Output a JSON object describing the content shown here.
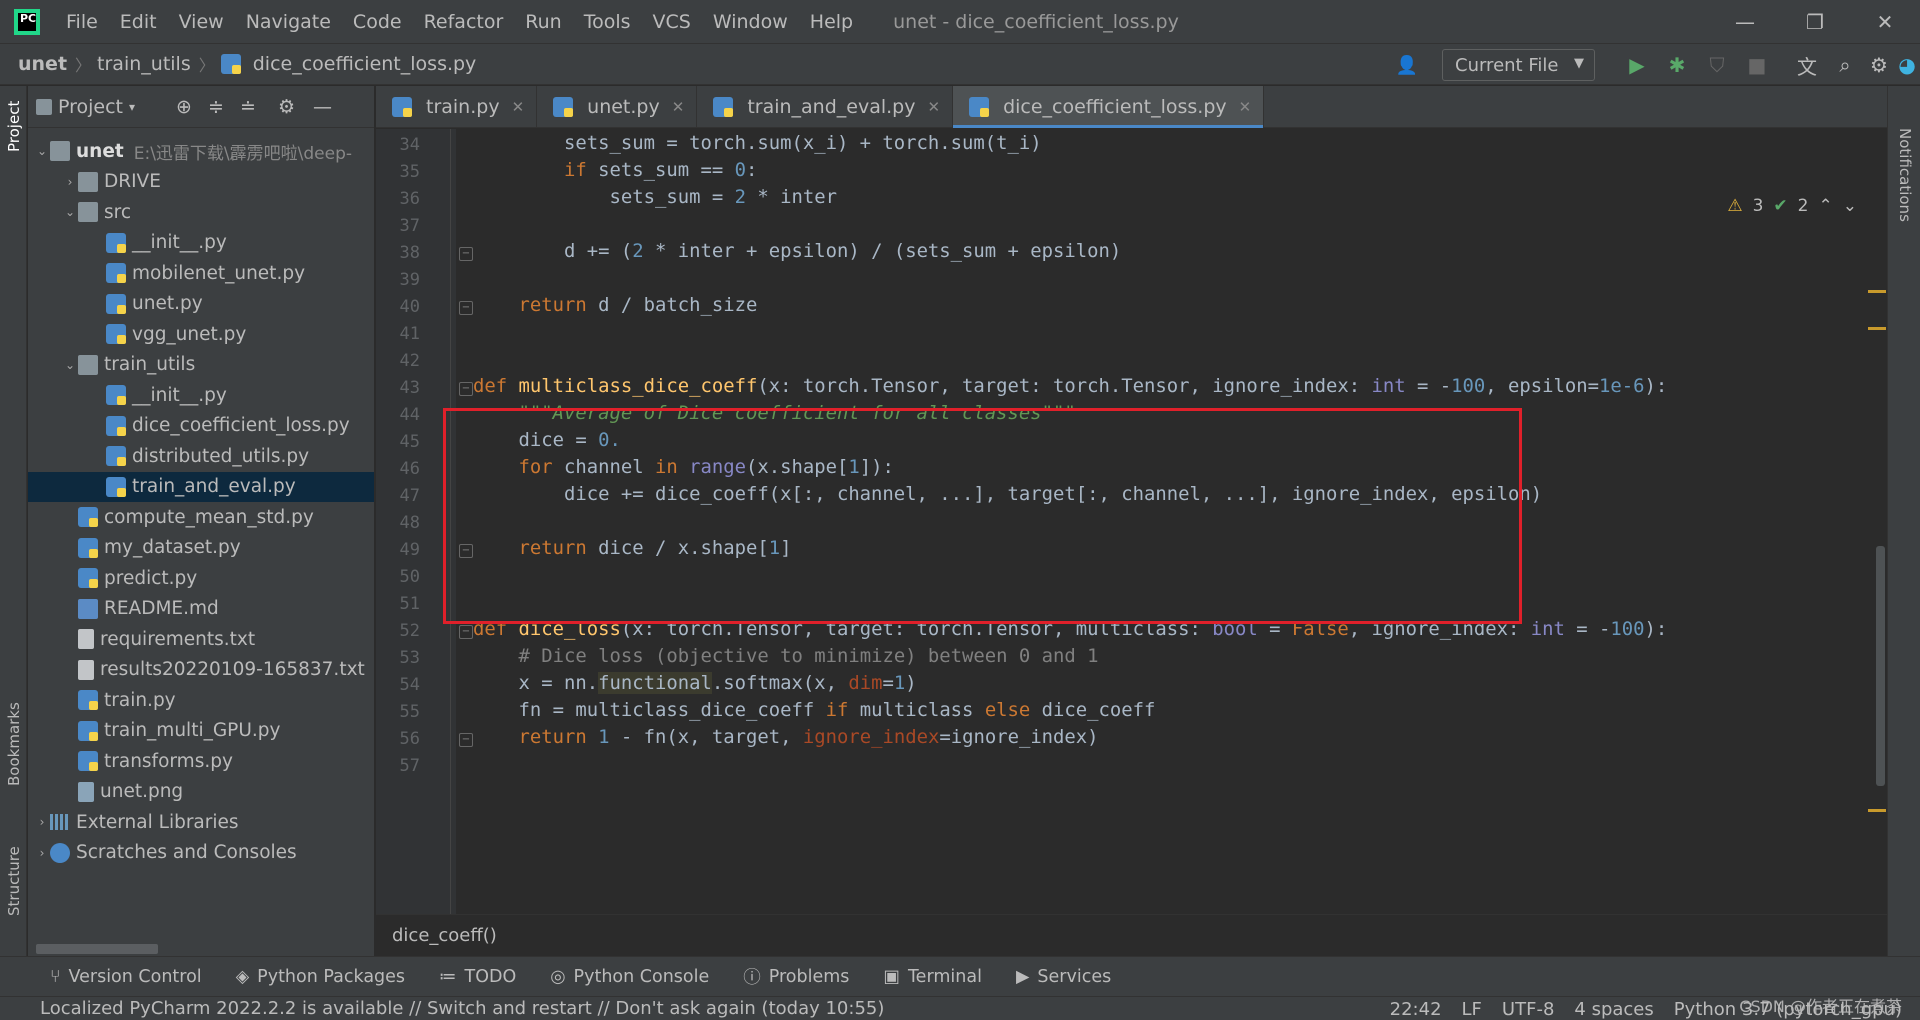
{
  "app": {
    "logo": "PC",
    "window_title": "unet - dice_coefficient_loss.py",
    "menus": [
      "File",
      "Edit",
      "View",
      "Navigate",
      "Code",
      "Refactor",
      "Run",
      "Tools",
      "VCS",
      "Window",
      "Help"
    ],
    "window_controls": [
      "—",
      "❐",
      "✕"
    ]
  },
  "nav": {
    "crumbs": [
      "unet",
      "train_utils",
      "dice_coefficient_loss.py"
    ],
    "run_config": "Current File"
  },
  "left_stripe": {
    "project": "Project",
    "bookmarks": "Bookmarks",
    "structure": "Structure"
  },
  "right_stripe": {
    "notifications": "Notifications"
  },
  "project": {
    "header": "Project",
    "tree": [
      {
        "label": "unet",
        "extra": "E:\\迅雷下载\\霹雳吧啦\\deep-",
        "depth": 0,
        "type": "folder",
        "arrow": "⌄",
        "bold": true
      },
      {
        "label": "DRIVE",
        "depth": 1,
        "type": "folder",
        "arrow": "›"
      },
      {
        "label": "src",
        "depth": 1,
        "type": "folder",
        "arrow": "⌄"
      },
      {
        "label": "__init__.py",
        "depth": 2,
        "type": "py"
      },
      {
        "label": "mobilenet_unet.py",
        "depth": 2,
        "type": "py"
      },
      {
        "label": "unet.py",
        "depth": 2,
        "type": "py"
      },
      {
        "label": "vgg_unet.py",
        "depth": 2,
        "type": "py"
      },
      {
        "label": "train_utils",
        "depth": 1,
        "type": "folder",
        "arrow": "⌄"
      },
      {
        "label": "__init__.py",
        "depth": 2,
        "type": "py"
      },
      {
        "label": "dice_coefficient_loss.py",
        "depth": 2,
        "type": "py"
      },
      {
        "label": "distributed_utils.py",
        "depth": 2,
        "type": "py"
      },
      {
        "label": "train_and_eval.py",
        "depth": 2,
        "type": "py",
        "selected": true
      },
      {
        "label": "compute_mean_std.py",
        "depth": 1,
        "type": "py"
      },
      {
        "label": "my_dataset.py",
        "depth": 1,
        "type": "py"
      },
      {
        "label": "predict.py",
        "depth": 1,
        "type": "py"
      },
      {
        "label": "README.md",
        "depth": 1,
        "type": "md"
      },
      {
        "label": "requirements.txt",
        "depth": 1,
        "type": "txt"
      },
      {
        "label": "results20220109-165837.txt",
        "depth": 1,
        "type": "txt"
      },
      {
        "label": "train.py",
        "depth": 1,
        "type": "py"
      },
      {
        "label": "train_multi_GPU.py",
        "depth": 1,
        "type": "py"
      },
      {
        "label": "transforms.py",
        "depth": 1,
        "type": "py"
      },
      {
        "label": "unet.png",
        "depth": 1,
        "type": "png"
      },
      {
        "label": "External Libraries",
        "depth": 0,
        "type": "lib",
        "arrow": "›"
      },
      {
        "label": "Scratches and Consoles",
        "depth": 0,
        "type": "scr",
        "arrow": "›"
      }
    ]
  },
  "editor": {
    "tabs": [
      {
        "label": "train.py",
        "active": false
      },
      {
        "label": "unet.py",
        "active": false
      },
      {
        "label": "train_and_eval.py",
        "active": false
      },
      {
        "label": "dice_coefficient_loss.py",
        "active": true
      }
    ],
    "inspections": {
      "warnings": "3",
      "ok": "2"
    },
    "line_numbers": [
      "34",
      "35",
      "36",
      "37",
      "38",
      "39",
      "40",
      "41",
      "42",
      "43",
      "44",
      "45",
      "46",
      "47",
      "48",
      "49",
      "50",
      "51",
      "52",
      "53",
      "54",
      "55",
      "56",
      "57"
    ],
    "code_breadcrumb": "dice_coeff()"
  },
  "toolbar": [
    "Version Control",
    "Python Packages",
    "TODO",
    "Python Console",
    "Problems",
    "Terminal",
    "Services"
  ],
  "status": {
    "message": "Localized PyCharm 2022.2.2 is available // Switch and restart // Don't ask again (today 10:55)",
    "position": "22:42",
    "line_sep": "LF",
    "encoding": "UTF-8",
    "indent": "4 spaces",
    "interpreter": "Python 3.7 (pytorch_gpu)",
    "watermark": "CSDN @作者正在煮茶"
  },
  "colors": {
    "keyword": "#cc7832",
    "function": "#ffc66d",
    "number": "#6897bb",
    "docstring": "#629755",
    "comment": "#808080",
    "highlight_box": "#e0202a"
  }
}
